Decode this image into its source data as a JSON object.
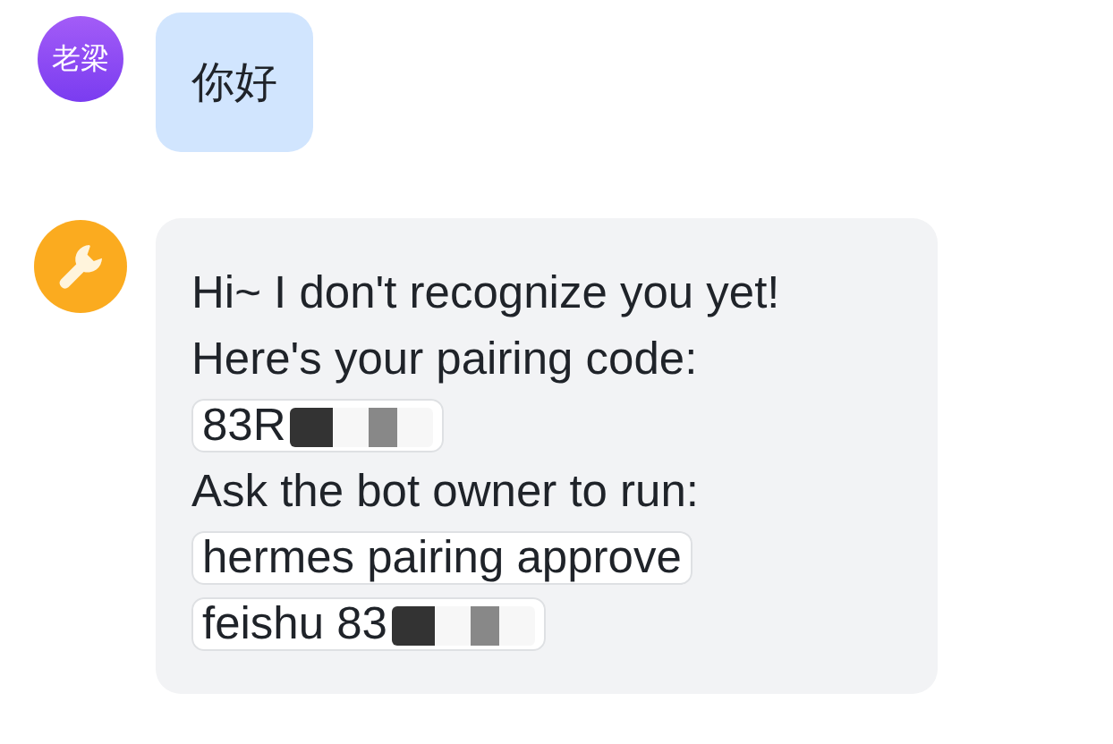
{
  "messages": [
    {
      "kind": "user",
      "avatar_text": "老梁",
      "text": "你好"
    },
    {
      "kind": "bot",
      "segments": [
        {
          "kind": "text",
          "text": "Hi~ I don't recognize you yet!"
        },
        {
          "kind": "text",
          "text": "Here's your pairing code:"
        },
        {
          "kind": "code",
          "text": "83R",
          "redacted": true
        },
        {
          "kind": "text",
          "text": "Ask the bot owner to run:"
        },
        {
          "kind": "code",
          "text": "hermes pairing approve",
          "redacted": false
        },
        {
          "kind": "code",
          "text": "feishu 83",
          "redacted": true
        }
      ]
    }
  ]
}
